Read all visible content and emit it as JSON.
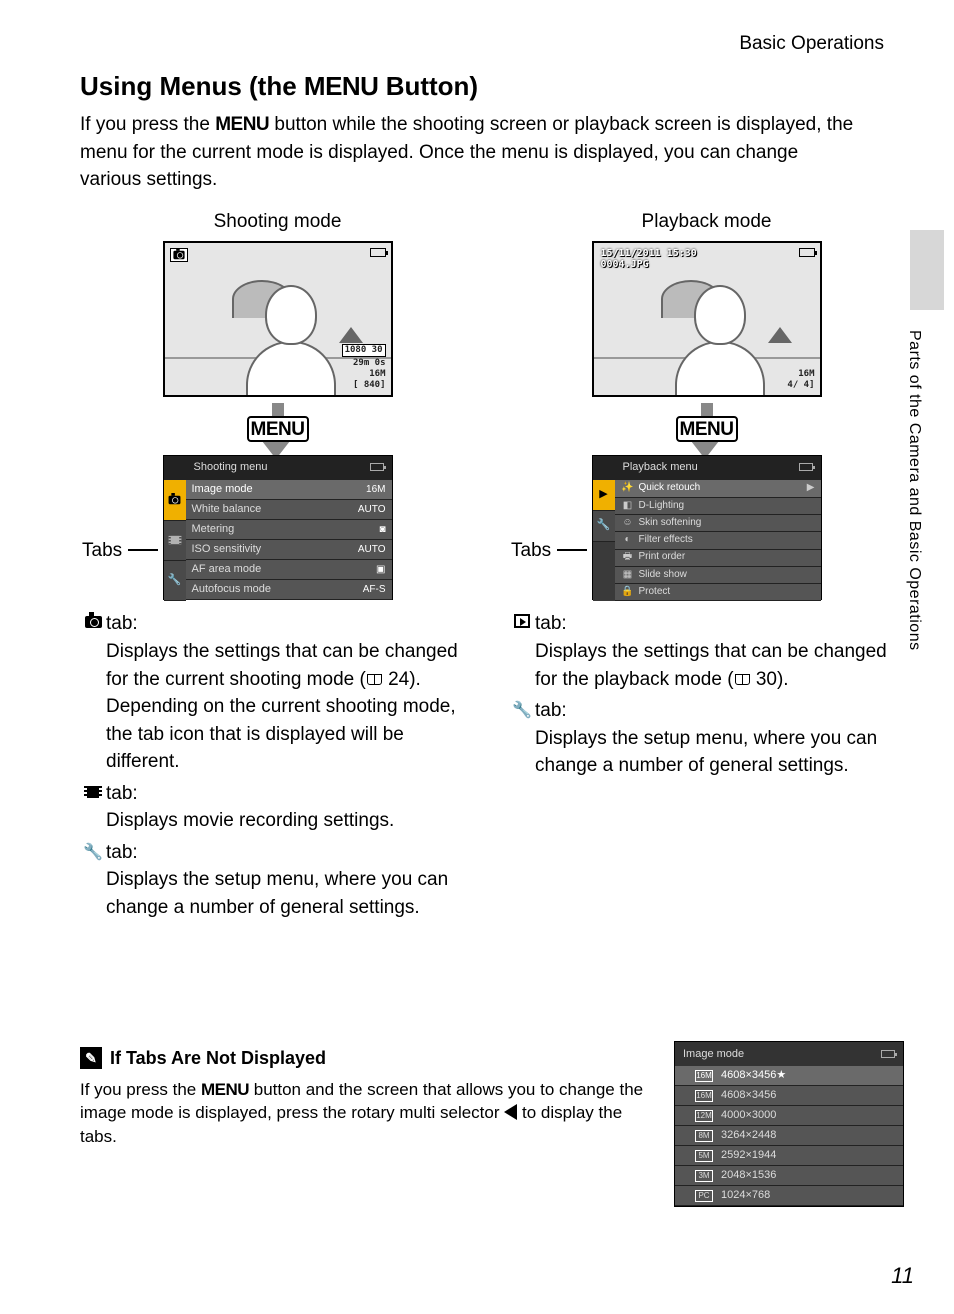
{
  "header": {
    "section": "Basic Operations"
  },
  "side": {
    "label": "Parts of the Camera and Basic Operations"
  },
  "title_parts": {
    "a": "Using Menus (the ",
    "b": "MENU",
    "c": " Button)"
  },
  "intro_parts": {
    "a": "If you press the ",
    "b": "MENU",
    "c": " button while the shooting screen or playback screen is displayed, the menu for the current mode is displayed. Once the menu is displayed, you can change various settings."
  },
  "shooting": {
    "title": "Shooting mode",
    "overlay": {
      "mov": "1080 30",
      "time": "29m 0s",
      "size": "16M",
      "shots": "[ 840]"
    },
    "menu": {
      "title": "Shooting menu",
      "items": [
        {
          "label": "Image mode",
          "val": "16M"
        },
        {
          "label": "White balance",
          "val": "AUTO"
        },
        {
          "label": "Metering",
          "val": "◙"
        },
        {
          "label": "ISO sensitivity",
          "val": "AUTO"
        },
        {
          "label": "AF area mode",
          "val": "▣"
        },
        {
          "label": "Autofocus mode",
          "val": "AF-S"
        }
      ]
    },
    "tabs_label": "Tabs",
    "expl": [
      {
        "ic": "cam",
        "head": "tab:",
        "body1": "Displays the settings that can be changed for the current shooting mode (",
        "ref": "24",
        "body2": "). Depending on the current shooting mode, the tab icon that is displayed will be different."
      },
      {
        "ic": "film",
        "head": "tab:",
        "body": "Displays movie recording settings."
      },
      {
        "ic": "wrench",
        "head": "tab:",
        "body": "Displays the setup menu, where you can change a number of general settings."
      }
    ]
  },
  "playback": {
    "title": "Playback mode",
    "datetime": "15/11/2011 15:30",
    "filename": "0004.JPG",
    "overlay": {
      "size": "16M",
      "count": "4/ 4]"
    },
    "menu": {
      "title": "Playback menu",
      "items": [
        {
          "label": "Quick retouch"
        },
        {
          "label": "D-Lighting"
        },
        {
          "label": "Skin softening"
        },
        {
          "label": "Filter effects"
        },
        {
          "label": "Print order"
        },
        {
          "label": "Slide show"
        },
        {
          "label": "Protect"
        }
      ]
    },
    "tabs_label": "Tabs",
    "expl": [
      {
        "ic": "play",
        "head": "tab:",
        "body1": "Displays the settings that can be changed for the playback mode (",
        "ref": "30",
        "body2": ")."
      },
      {
        "ic": "wrench",
        "head": "tab:",
        "body": "Displays the setup menu, where you can change a number of general settings."
      }
    ]
  },
  "menu_btn_label": "MENU",
  "note": {
    "title": "If Tabs Are Not Displayed",
    "body_parts": {
      "a": "If you press the ",
      "b": "MENU",
      "c": " button and the screen that allows you to change the image mode is displayed, press the rotary multi selector ",
      "d": " to display the tabs."
    },
    "image_mode": {
      "title": "Image mode",
      "options": [
        {
          "badge": "16M",
          "label": "4608×3456★"
        },
        {
          "badge": "16M",
          "label": "4608×3456"
        },
        {
          "badge": "12M",
          "label": "4000×3000"
        },
        {
          "badge": "8M",
          "label": "3264×2448"
        },
        {
          "badge": "5M",
          "label": "2592×1944"
        },
        {
          "badge": "3M",
          "label": "2048×1536"
        },
        {
          "badge": "PC",
          "label": "1024×768"
        }
      ]
    }
  },
  "page_number": "11"
}
